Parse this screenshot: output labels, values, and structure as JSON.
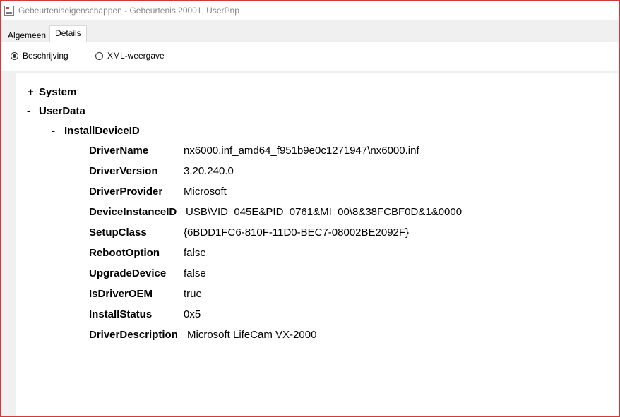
{
  "window": {
    "title": "Gebeurteniseigenschappen - Gebeurtenis 20001, UserPnp"
  },
  "tabs": [
    {
      "label": "Algemeen",
      "active": false
    },
    {
      "label": "Details",
      "active": true
    }
  ],
  "view_mode": {
    "options": [
      {
        "label": "Beschrijving",
        "selected": true
      },
      {
        "label": "XML-weergave",
        "selected": false
      }
    ]
  },
  "tree": {
    "system": {
      "toggle": "+",
      "label": "System"
    },
    "userdata": {
      "toggle": "-",
      "label": "UserData"
    },
    "install": {
      "toggle": "-",
      "label": "InstallDeviceID"
    },
    "properties": [
      {
        "name": "DriverName",
        "value": "nx6000.inf_amd64_f951b9e0c1271947\\nx6000.inf"
      },
      {
        "name": "DriverVersion",
        "value": "3.20.240.0"
      },
      {
        "name": "DriverProvider",
        "value": "Microsoft"
      },
      {
        "name": "DeviceInstanceID",
        "value": "USB\\VID_045E&PID_0761&MI_00\\8&38FCBF0D&1&0000"
      },
      {
        "name": "SetupClass",
        "value": "{6BDD1FC6-810F-11D0-BEC7-08002BE2092F}"
      },
      {
        "name": "RebootOption",
        "value": "false"
      },
      {
        "name": "UpgradeDevice",
        "value": "false"
      },
      {
        "name": "IsDriverOEM",
        "value": "true"
      },
      {
        "name": "InstallStatus",
        "value": "0x5"
      },
      {
        "name": "DriverDescription",
        "value": "Microsoft LifeCam VX-2000"
      }
    ]
  }
}
